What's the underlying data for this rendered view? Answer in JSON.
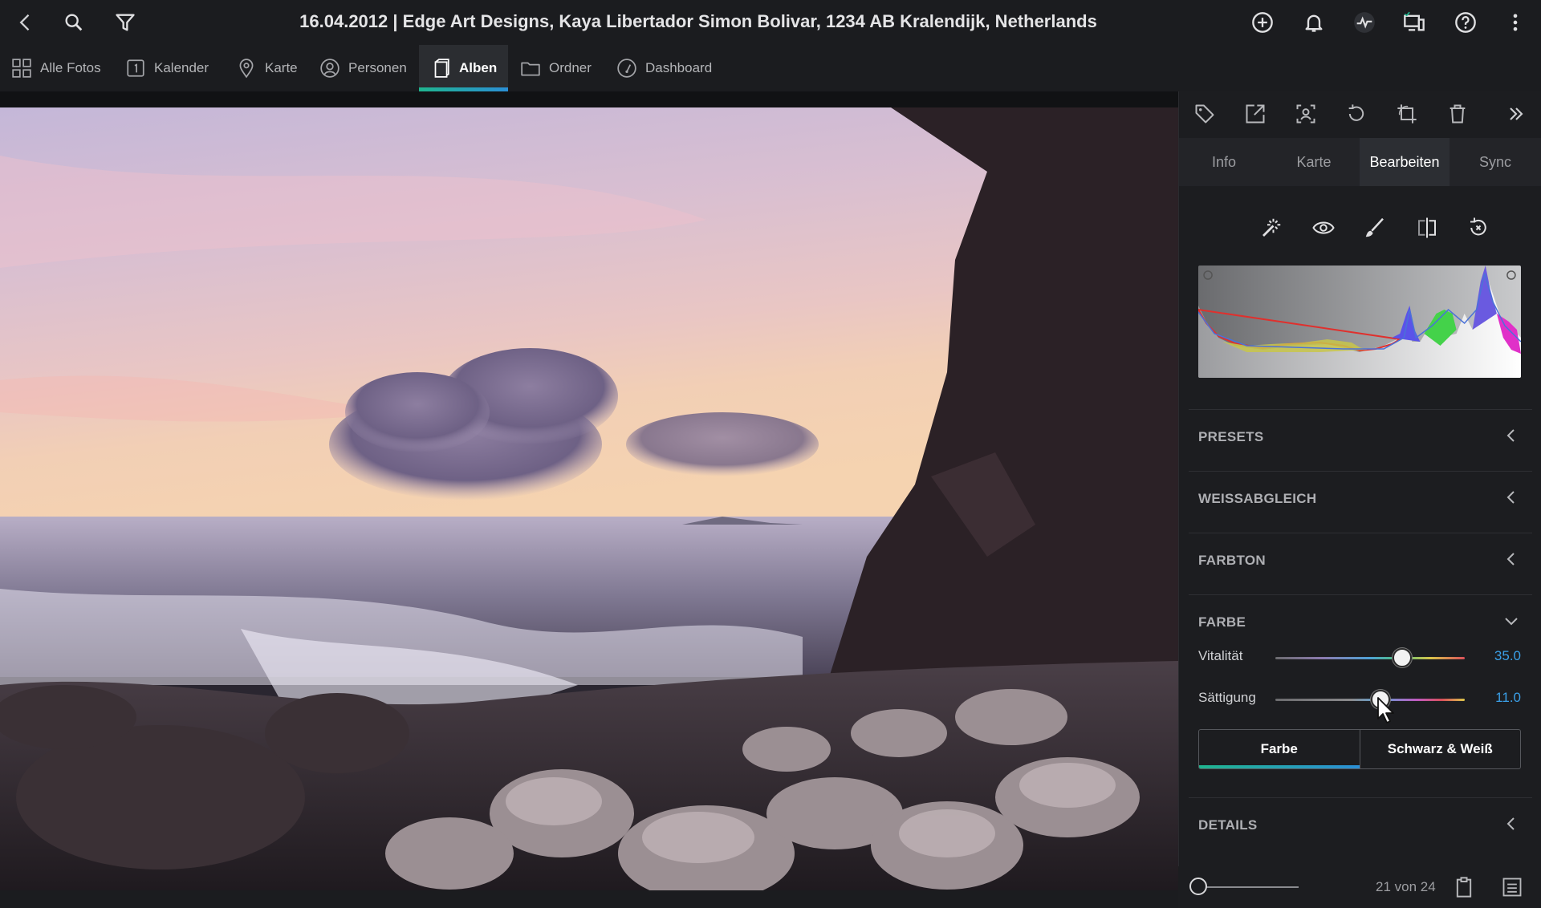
{
  "window": {
    "title": "16.04.2012 | Edge Art Designs, Kaya Libertador Simon Bolivar, 1234 AB Kralendijk, Netherlands"
  },
  "topbar": {
    "left_icons": [
      "back-chevron-icon",
      "search-icon",
      "filter-icon"
    ],
    "right_icons": [
      "add-icon",
      "bell-icon",
      "activity-icon",
      "devices-icon",
      "help-icon",
      "more-icon"
    ]
  },
  "nav": {
    "items": [
      {
        "label": "Alle Fotos",
        "icon": "grid-icon"
      },
      {
        "label": "Kalender",
        "icon": "calendar-icon"
      },
      {
        "label": "Karte",
        "icon": "map-pin-icon"
      },
      {
        "label": "Personen",
        "icon": "person-icon"
      },
      {
        "label": "Alben",
        "icon": "album-icon",
        "active": true
      },
      {
        "label": "Ordner",
        "icon": "folder-icon"
      },
      {
        "label": "Dashboard",
        "icon": "gauge-icon"
      }
    ]
  },
  "panel": {
    "toolbar_icons": [
      "tag-icon",
      "share-icon",
      "face-scan-icon",
      "rotate-icon",
      "crop-icon",
      "trash-icon",
      "collapse-panel-icon"
    ],
    "tabs": [
      {
        "label": "Info"
      },
      {
        "label": "Karte"
      },
      {
        "label": "Bearbeiten",
        "active": true
      },
      {
        "label": "Sync"
      }
    ],
    "edit_tools": [
      "magic-wand-icon",
      "eye-icon",
      "brush-icon",
      "compare-icon",
      "reset-icon"
    ],
    "sections": {
      "presets": "PRESETS",
      "white_balance": "WEISSABGLEICH",
      "tone": "FARBTON",
      "color": "FARBE",
      "details": "DETAILS"
    },
    "sliders": {
      "vibrance": {
        "label": "Vitalität",
        "value": "35.0",
        "fraction": 0.67
      },
      "saturation": {
        "label": "Sättigung",
        "value": "11.0",
        "fraction": 0.555
      }
    },
    "mode": {
      "color_label": "Farbe",
      "bw_label": "Schwarz & Weiß",
      "selected": "Farbe"
    }
  },
  "footer": {
    "counter": "21 von 24"
  },
  "colors": {
    "accent_blue": "#3a9fe6",
    "accent_green": "#1fb58f"
  }
}
